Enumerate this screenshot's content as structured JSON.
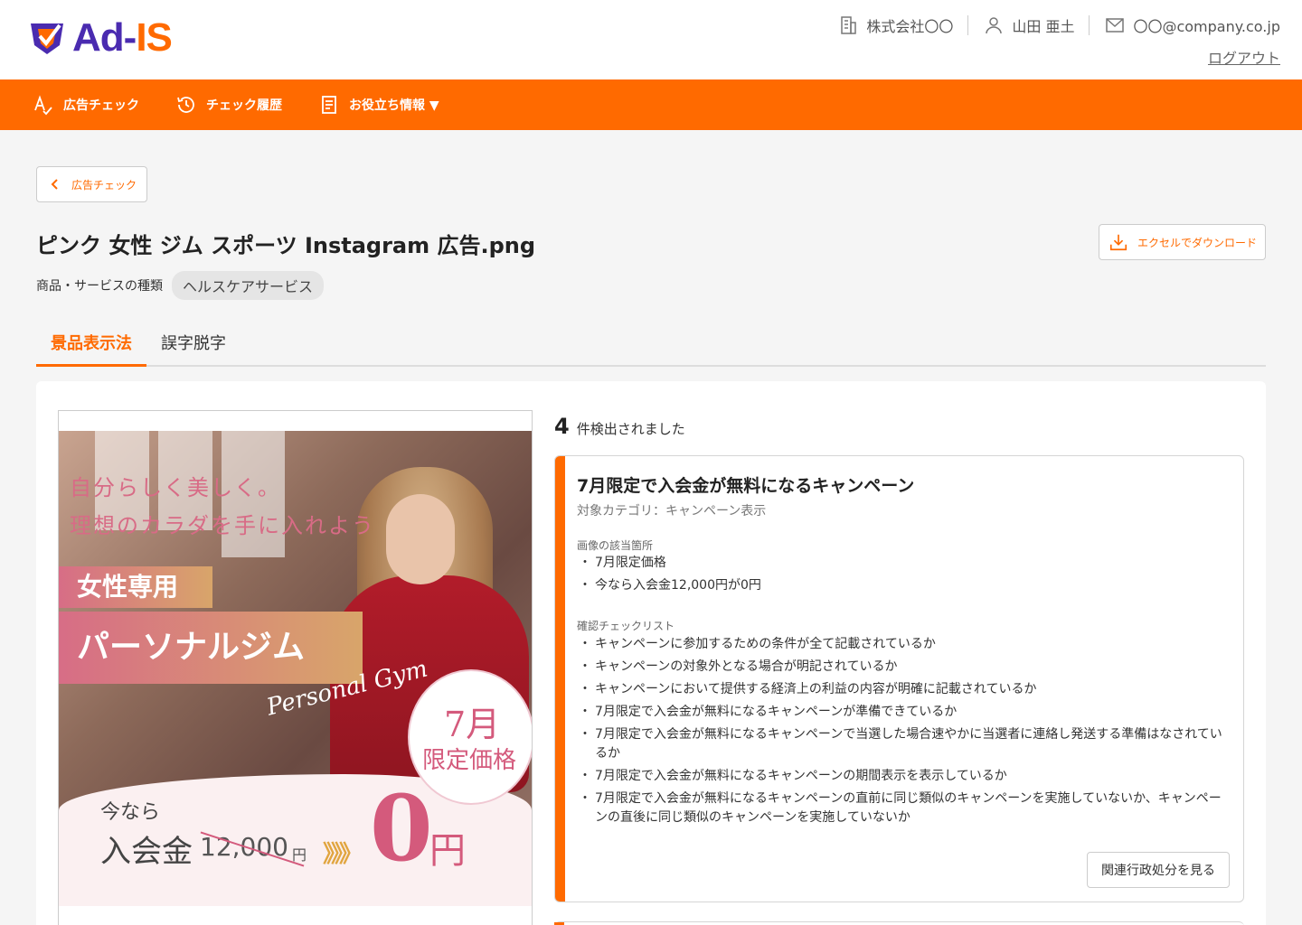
{
  "header": {
    "logo_left": "Ad-",
    "logo_right": "IS",
    "company": "株式会社〇〇",
    "user": "山田 亜土",
    "email": "〇〇@company.co.jp",
    "logout": "ログアウト"
  },
  "nav": {
    "items": [
      {
        "label": "広告チェック",
        "icon": "ad-check-icon"
      },
      {
        "label": "チェック履歴",
        "icon": "history-icon"
      },
      {
        "label": "お役立ち情報 ▼",
        "icon": "document-icon"
      }
    ]
  },
  "page": {
    "back_label": "広告チェック",
    "title": "ピンク 女性 ジム スポーツ Instagram 広告.png",
    "download_label": "エクセルでダウンロード",
    "service_label": "商品・サービスの種類",
    "service_value": "ヘルスケアサービス"
  },
  "tabs": [
    {
      "label": "景品表示法",
      "active": true
    },
    {
      "label": "誤字脱字",
      "active": false
    }
  ],
  "ad_image": {
    "line1": "自分らしく美しく。",
    "line2": "理想のカラダを手に入れよう",
    "badge1": "女性専用",
    "badge2": "パーソナルジム",
    "script": "Personal Gym",
    "circle_line1": "7月",
    "circle_line2": "限定価格",
    "now": "今なら",
    "fee": "入会金",
    "old_price": "12,000",
    "old_price_unit": "円",
    "arrows": "》》》",
    "new_price": "0",
    "new_price_unit": "円"
  },
  "results": {
    "count": "4",
    "count_suffix": "件検出されました",
    "card": {
      "title": "7月限定で入会金が無料になるキャンペーン",
      "category": "対象カテゴリ：キャンペーン表示",
      "section1": "画像の該当箇所",
      "items1": [
        "7月限定価格",
        "今なら入会金12,000円が0円"
      ],
      "section2": "確認チェックリスト",
      "items2": [
        "キャンペーンに参加するための条件が全て記載されているか",
        "キャンペーンの対象外となる場合が明記されているか",
        "キャンペーンにおいて提供する経済上の利益の内容が明確に記載されているか",
        "7月限定で入会金が無料になるキャンペーンが準備できているか",
        "7月限定で入会金が無料になるキャンペーンで当選した場合速やかに当選者に連絡し発送する準備はなされているか",
        "7月限定で入会金が無料になるキャンペーンの期間表示を表示しているか",
        "7月限定で入会金が無料になるキャンペーンの直前に同じ類似のキャンペーンを実施していないか、キャンペーンの直後に同じ類似のキャンペーンを実施していないか"
      ],
      "button": "関連行政処分を見る"
    }
  },
  "colors": {
    "accent": "#ff6a00",
    "brand_purple": "#4a2bb0"
  }
}
